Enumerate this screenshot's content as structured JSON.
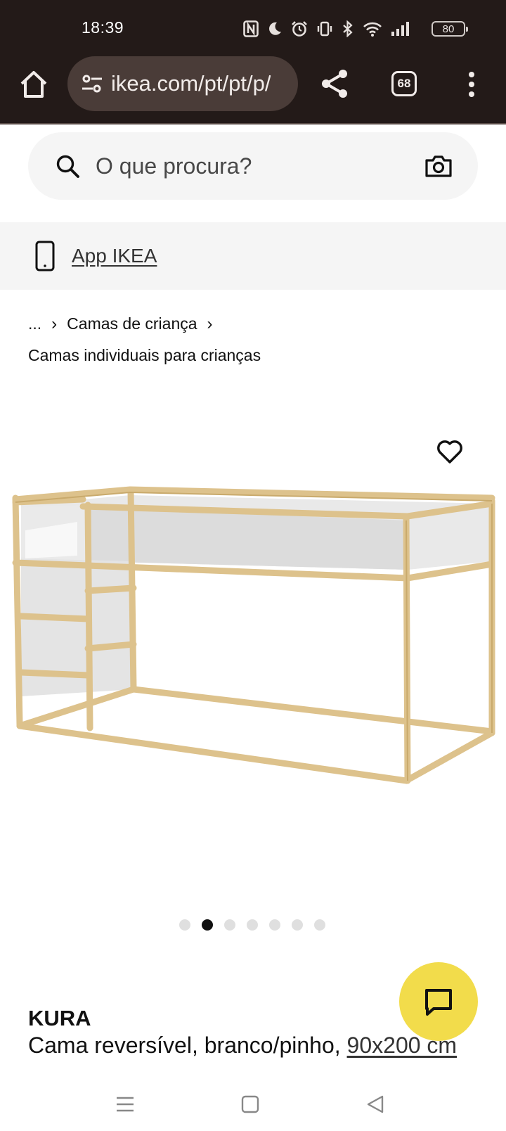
{
  "status_bar": {
    "time": "18:39",
    "battery": "80",
    "icons": [
      "nfc-icon",
      "do-not-disturb-moon-icon",
      "alarm-icon",
      "vibrate-icon",
      "bluetooth-icon",
      "wifi-icon",
      "signal-icon",
      "battery-icon"
    ]
  },
  "browser": {
    "url": "ikea.com/pt/pt/p/",
    "tab_count": "68",
    "icons": [
      "home-icon",
      "site-settings-icon",
      "share-icon",
      "tabs-icon",
      "more-vert-icon"
    ]
  },
  "search": {
    "placeholder": "O que procura?",
    "icons": [
      "search-icon",
      "camera-icon"
    ]
  },
  "app_banner": {
    "label": "App IKEA",
    "icon": "smartphone-icon"
  },
  "breadcrumb": {
    "ellipsis": "...",
    "separator": "›",
    "level1": "Camas de criança",
    "level2": "Camas individuais para crianças"
  },
  "carousel": {
    "total_images": 7,
    "active_index": 1
  },
  "product": {
    "name": "KURA",
    "description": "Cama reversível, branco/pinho, ",
    "size": "90x200 cm"
  },
  "colors": {
    "browser_chrome": "#231a18",
    "url_pill": "#4a3c38",
    "ikea_yellow": "#f2dc4b",
    "surface_grey": "#f5f5f5"
  },
  "nav_bar": {
    "icons": [
      "recent-apps-icon",
      "home-square-icon",
      "back-triangle-icon"
    ]
  }
}
